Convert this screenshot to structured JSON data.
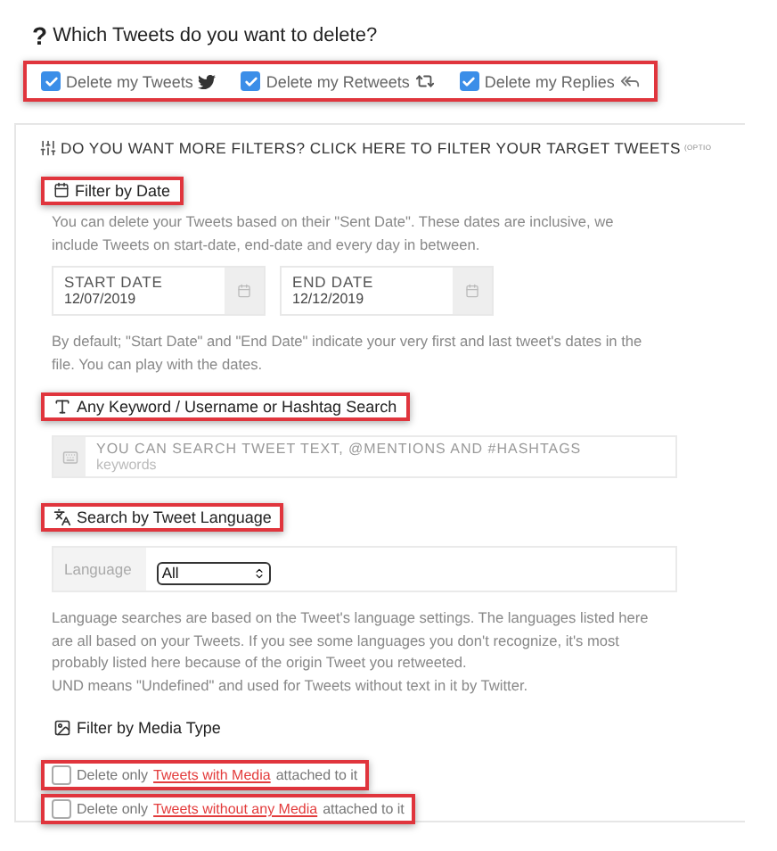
{
  "question": {
    "mark": "?",
    "text": "Which Tweets do you want to delete?"
  },
  "tweet_types": {
    "highlighted": true,
    "items": [
      {
        "label": "Delete my Tweets",
        "checked": true,
        "kind": "tweets"
      },
      {
        "label": "Delete my Retweets",
        "checked": true,
        "kind": "retweets"
      },
      {
        "label": "Delete my Replies",
        "checked": true,
        "kind": "replies"
      }
    ]
  },
  "filters_header": {
    "title": "DO YOU WANT MORE FILTERS? CLICK HERE TO FILTER YOUR TARGET TWEETS",
    "note": "(OPTIO"
  },
  "date_filter": {
    "title": "Filter by Date",
    "highlighted": true,
    "description": "You can delete your Tweets based on their \"Sent Date\". These dates are inclusive, we include Tweets on start-date, end-date and every day in between.",
    "fields": [
      {
        "label": "START DATE",
        "value": "12/07/2019"
      },
      {
        "label": "END DATE",
        "value": "12/12/2019"
      }
    ],
    "note": "By default; \"Start Date\" and \"End Date\" indicate your very first and last tweet's dates in the file. You can play with the dates."
  },
  "keyword_filter": {
    "title": "Any Keyword / Username or Hashtag Search",
    "highlighted": true,
    "label": "YOU CAN SEARCH TWEET TEXT, @MENTIONS AND #HASHTAGS",
    "placeholder": "keywords"
  },
  "language_filter": {
    "title": "Search by Tweet Language",
    "highlighted": true,
    "label": "Language",
    "value": "All",
    "description": [
      "Language searches are based on the Tweet's language settings. The languages listed here are all based on your Tweets. If you see some languages you don't recognize, it's most probably listed here because of the origin Tweet you retweeted.",
      "UND means \"Undefined\" and used for Tweets without text in it by Twitter."
    ]
  },
  "media_filter": {
    "title": "Filter by Media Type",
    "highlighted": false,
    "options": [
      {
        "prefix": "Delete only",
        "link": "Tweets with Media",
        "suffix": "attached to it",
        "checked": false,
        "highlighted": true
      },
      {
        "prefix": "Delete only",
        "link": "Tweets without any Media",
        "suffix": "attached to it",
        "checked": false,
        "highlighted": true
      }
    ]
  }
}
